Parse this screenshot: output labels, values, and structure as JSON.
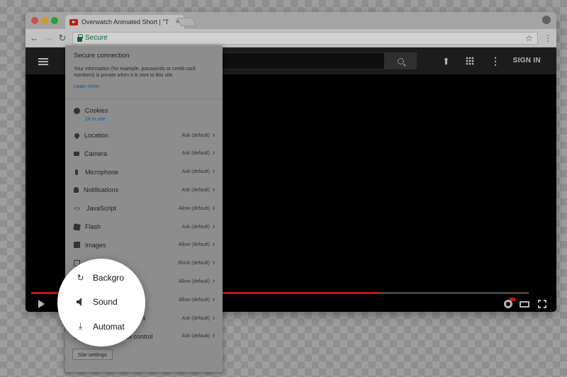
{
  "browser": {
    "tab_title": "Overwatch Animated Short | \"T",
    "tab_close": "×",
    "nav": {
      "back": "←",
      "forward": "→",
      "reload": "↻"
    },
    "address": {
      "secure_label": "Secure"
    },
    "star": "☆",
    "menu": "⋮"
  },
  "youtube": {
    "logo_text": "Y",
    "upload_glyph": "⬆",
    "more_glyph": "⋮",
    "sign_in": "SIGN IN",
    "progress": 0.7
  },
  "popup": {
    "title": "Secure connection",
    "description": "Your information (for example, passwords or credit card numbers) is private when it is sent to this site.",
    "learn_more": "Learn more",
    "cookies": {
      "label": "Cookies",
      "sub": "18 in use"
    },
    "permissions": [
      {
        "label": "Location",
        "value": "Ask (default)",
        "icon": "location-icon"
      },
      {
        "label": "Camera",
        "value": "Ask (default)",
        "icon": "camera-icon"
      },
      {
        "label": "Microphone",
        "value": "Ask (default)",
        "icon": "microphone-icon"
      },
      {
        "label": "Notifications",
        "value": "Ask (default)",
        "icon": "notifications-icon"
      },
      {
        "label": "JavaScript",
        "value": "Allow (default)",
        "icon": "code-icon"
      },
      {
        "label": "Flash",
        "value": "Ask (default)",
        "icon": "puzzle-icon"
      },
      {
        "label": "Images",
        "value": "Allow (default)",
        "icon": "image-icon"
      },
      {
        "label": "Popups",
        "value": "Block (default)",
        "icon": "popup-icon"
      },
      {
        "label": "Background sync",
        "value": "Allow (default)",
        "icon": "sync-icon"
      },
      {
        "label": "Sound",
        "value": "Allow (default)",
        "icon": "sound-icon"
      },
      {
        "label": "Automatic downloads",
        "value": "Ask (default)",
        "icon": "download-icon"
      },
      {
        "label": "MIDI devices full control",
        "value": "Ask (default)",
        "icon": "midi-icon"
      }
    ],
    "caret": "⌃⌄",
    "site_settings": "Site settings"
  },
  "magnifier": {
    "rows": [
      {
        "label": "Backgro",
        "icon": "sync-icon",
        "glyph": "↻"
      },
      {
        "label": "Sound",
        "icon": "sound-icon"
      },
      {
        "label": "Automat",
        "icon": "download-icon",
        "glyph": "⤓"
      }
    ]
  }
}
